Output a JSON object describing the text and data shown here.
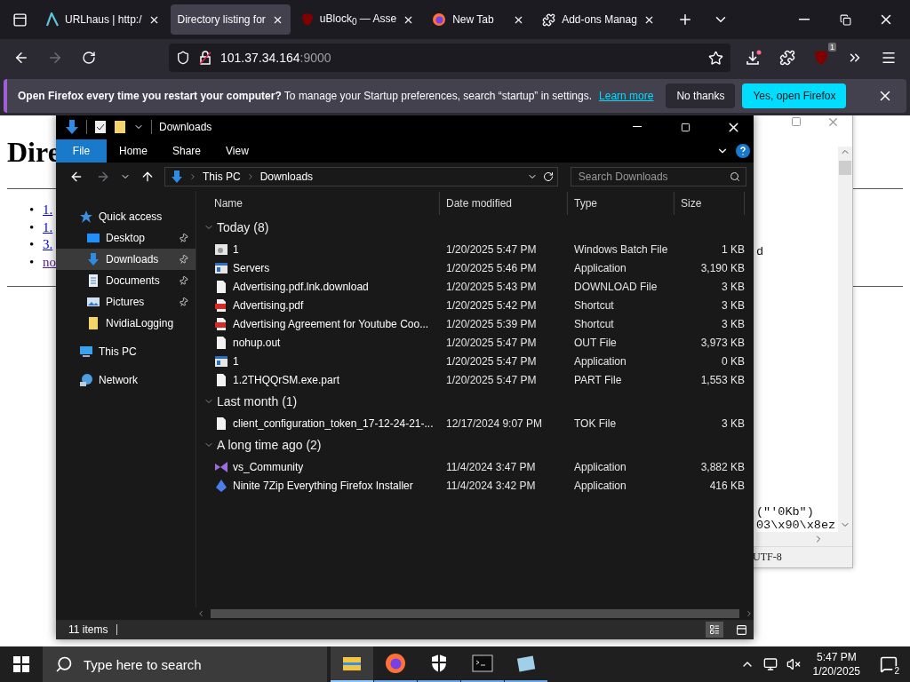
{
  "browser": {
    "tabs": [
      {
        "label": "URLhaus | http:/",
        "kind": "urlhaus",
        "selected": false
      },
      {
        "label": "Directory listing for",
        "kind": "none",
        "selected": true
      },
      {
        "label": "uBlock$_{0}$ — Asse",
        "kind": "ublock",
        "selected": false
      },
      {
        "label": "New Tab",
        "kind": "firefox",
        "selected": false
      },
      {
        "label": "Add-ons Manag",
        "kind": "addons",
        "selected": false
      }
    ],
    "nav_buttons": [
      {
        "kind": "back",
        "disabled": false
      },
      {
        "kind": "forward",
        "disabled": true
      },
      {
        "kind": "reload",
        "disabled": false
      }
    ],
    "url": {
      "host": "101.37.34.164",
      "port": ":9000"
    },
    "ublock_badge": "1",
    "notification": {
      "message": "**Open Firefox every time you restart your computer?** To manage your Startup preferences, search “startup” in settings.",
      "link": "Learn more",
      "buttons": [
        {
          "label": "No thanks",
          "kind": "secondary"
        },
        {
          "label": "Yes, open Firefox",
          "kind": "primary"
        }
      ]
    }
  },
  "page": {
    "heading": "Dire",
    "links": [
      {
        "marker": "•",
        "label": "1.",
        "visited": false
      },
      {
        "marker": "•",
        "label": "1.",
        "visited": false
      },
      {
        "marker": "•",
        "label": "3.",
        "visited": false
      },
      {
        "marker": "•",
        "label": "no",
        "visited": true
      }
    ]
  },
  "notepad": {
    "lines": [
      "d",
      "(\"'0Kb\")",
      "03\\x90\\x8ez"
    ],
    "encoding": "UTF-8"
  },
  "explorer": {
    "title": "Downloads",
    "ribbon_tabs": [
      {
        "label": "File",
        "selected": true
      },
      {
        "label": "Home",
        "selected": false
      },
      {
        "label": "Share",
        "selected": false
      },
      {
        "label": "View",
        "selected": false
      }
    ],
    "nav_buttons": [
      {
        "kind": "back",
        "disabled": false
      },
      {
        "kind": "forward",
        "disabled": true
      },
      {
        "kind": "recent",
        "disabled": false
      },
      {
        "kind": "up",
        "disabled": false
      }
    ],
    "breadcrumb": [
      "This PC",
      "Downloads"
    ],
    "search": {
      "placeholder": "Search Downloads"
    },
    "nav_pane": [
      {
        "label": "Quick access",
        "kind": "star",
        "selected": false,
        "children": [
          {
            "label": "Desktop",
            "kind": "desktop",
            "selected": false,
            "pinned": true
          },
          {
            "label": "Downloads",
            "kind": "download",
            "selected": true,
            "pinned": true
          },
          {
            "label": "Documents",
            "kind": "document",
            "selected": false,
            "pinned": true
          },
          {
            "label": "Pictures",
            "kind": "pictures",
            "selected": false,
            "pinned": true
          },
          {
            "label": "NvidiaLogging",
            "kind": "folder",
            "selected": false,
            "pinned": false
          }
        ]
      },
      {
        "label": "This PC",
        "kind": "pc",
        "selected": false
      },
      {
        "label": "Network",
        "kind": "network",
        "selected": false
      }
    ],
    "columns": [
      "Name",
      "Date modified",
      "Type",
      "Size"
    ],
    "groups": [
      {
        "title": "Today (8)",
        "expanded": true,
        "files": [
          {
            "name": "1",
            "date": "1/20/2025 5:47 PM",
            "type": "Windows Batch File",
            "size": "1 KB",
            "kind": "batch"
          },
          {
            "name": "Servers",
            "date": "1/20/2025 5:46 PM",
            "type": "Application",
            "size": "3,190 KB",
            "kind": "app"
          },
          {
            "name": "Advertising.pdf.lnk.download",
            "date": "1/20/2025 5:43 PM",
            "type": "DOWNLOAD File",
            "size": "3 KB",
            "kind": "file"
          },
          {
            "name": "Advertising.pdf",
            "date": "1/20/2025 5:42 PM",
            "type": "Shortcut",
            "size": "3 KB",
            "kind": "pdf"
          },
          {
            "name": "Advertising Agreement for Youtube Coo...",
            "date": "1/20/2025 5:39 PM",
            "type": "Shortcut",
            "size": "3 KB",
            "kind": "pdf"
          },
          {
            "name": "nohup.out",
            "date": "1/20/2025 5:47 PM",
            "type": "OUT File",
            "size": "3,973 KB",
            "kind": "file"
          },
          {
            "name": "1",
            "date": "1/20/2025 5:47 PM",
            "type": "Application",
            "size": "0 KB",
            "kind": "app"
          },
          {
            "name": "1.2THQQrSM.exe.part",
            "date": "1/20/2025 5:47 PM",
            "type": "PART File",
            "size": "1,553 KB",
            "kind": "file"
          }
        ]
      },
      {
        "title": "Last month (1)",
        "expanded": true,
        "files": [
          {
            "name": "client_configuration_token_17-12-24-21-...",
            "date": "12/17/2024 9:07 PM",
            "type": "TOK File",
            "size": "3 KB",
            "kind": "file"
          }
        ]
      },
      {
        "title": "A long time ago (2)",
        "expanded": true,
        "files": [
          {
            "name": "vs_Community",
            "date": "11/4/2024 3:47 PM",
            "type": "Application",
            "size": "3,882 KB",
            "kind": "vs"
          },
          {
            "name": "Ninite 7Zip Everything Firefox Installer",
            "date": "11/4/2024 3:42 PM",
            "type": "Application",
            "size": "416 KB",
            "kind": "ninite"
          }
        ]
      }
    ],
    "status": "11 items",
    "view_buttons": [
      {
        "kind": "details",
        "selected": true
      },
      {
        "kind": "tiles",
        "selected": false
      }
    ]
  },
  "taskbar": {
    "search": {
      "placeholder": "Type here to search"
    },
    "apps": [
      {
        "kind": "explorer",
        "selected": true
      },
      {
        "kind": "firefox",
        "selected": false
      },
      {
        "kind": "shield",
        "selected": false
      },
      {
        "kind": "terminal",
        "selected": false
      },
      {
        "kind": "notepad",
        "selected": false
      }
    ],
    "time": "5:47 PM",
    "date": "1/20/2025",
    "notifications": "2"
  }
}
